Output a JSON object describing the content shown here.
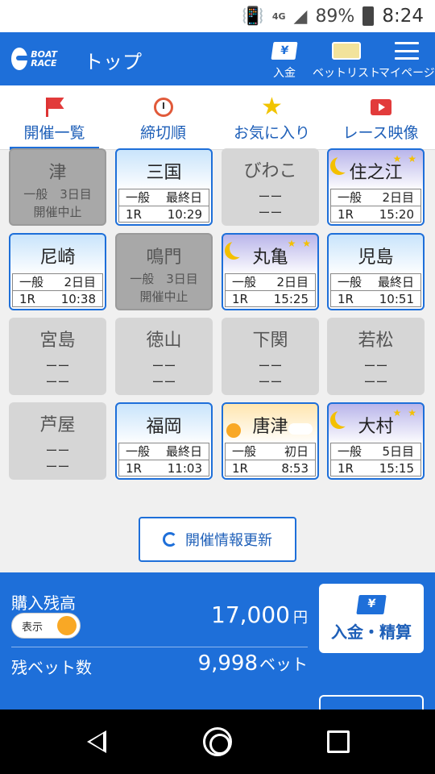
{
  "status": {
    "signal": "4G",
    "battery": "89%",
    "time": "8:24"
  },
  "appbar": {
    "logo_text": "BOAT RACE",
    "title": "トップ",
    "actions": [
      {
        "label": "入金",
        "icon": "yen-ticket-icon"
      },
      {
        "label": "ベットリスト",
        "icon": "bet-list-icon"
      },
      {
        "label": "マイページ",
        "icon": "menu-icon"
      }
    ]
  },
  "tabs": [
    {
      "label": "開催一覧",
      "icon": "flag-icon",
      "active": true
    },
    {
      "label": "締切順",
      "icon": "alarm-clock-icon"
    },
    {
      "label": "お気に入り",
      "icon": "star-icon"
    },
    {
      "label": "レース映像",
      "icon": "video-icon"
    }
  ],
  "venues": [
    {
      "name": "津",
      "state": "cancel",
      "grade": "一般",
      "day": "3日目",
      "note": "開催中止"
    },
    {
      "name": "三国",
      "state": "active",
      "grade": "一般",
      "day": "最終日",
      "race": "1R",
      "time": "10:29"
    },
    {
      "name": "びわこ",
      "state": "inactive",
      "dash1": "ーー",
      "dash2": "ーー"
    },
    {
      "name": "住之江",
      "state": "night",
      "grade": "一般",
      "day": "2日目",
      "race": "1R",
      "time": "15:20"
    },
    {
      "name": "尼崎",
      "state": "active",
      "grade": "一般",
      "day": "2日目",
      "race": "1R",
      "time": "10:38"
    },
    {
      "name": "鳴門",
      "state": "cancel",
      "grade": "一般",
      "day": "3日目",
      "note": "開催中止"
    },
    {
      "name": "丸亀",
      "state": "night",
      "grade": "一般",
      "day": "2日目",
      "race": "1R",
      "time": "15:25"
    },
    {
      "name": "児島",
      "state": "active",
      "grade": "一般",
      "day": "最終日",
      "race": "1R",
      "time": "10:51"
    },
    {
      "name": "宮島",
      "state": "inactive",
      "dash1": "ーー",
      "dash2": "ーー"
    },
    {
      "name": "徳山",
      "state": "inactive",
      "dash1": "ーー",
      "dash2": "ーー"
    },
    {
      "name": "下関",
      "state": "inactive",
      "dash1": "ーー",
      "dash2": "ーー"
    },
    {
      "name": "若松",
      "state": "inactive",
      "dash1": "ーー",
      "dash2": "ーー"
    },
    {
      "name": "芦屋",
      "state": "inactive",
      "dash1": "ーー",
      "dash2": "ーー"
    },
    {
      "name": "福岡",
      "state": "active",
      "grade": "一般",
      "day": "最終日",
      "race": "1R",
      "time": "11:03"
    },
    {
      "name": "唐津",
      "state": "morning",
      "grade": "一般",
      "day": "初日",
      "race": "1R",
      "time": "8:53"
    },
    {
      "name": "大村",
      "state": "night",
      "grade": "一般",
      "day": "5日目",
      "race": "1R",
      "time": "15:15"
    }
  ],
  "update_button": "開催情報更新",
  "panel": {
    "balance_label": "購入残高",
    "toggle_label": "表示",
    "balance": "17,000",
    "balance_unit": "円",
    "bets_label": "残ベット数",
    "bets": "9,998",
    "bets_unit": "ベット",
    "deposit_button": "入金・精算"
  },
  "colors": {
    "primary": "#1e6fd9",
    "accent": "#f9a825"
  }
}
